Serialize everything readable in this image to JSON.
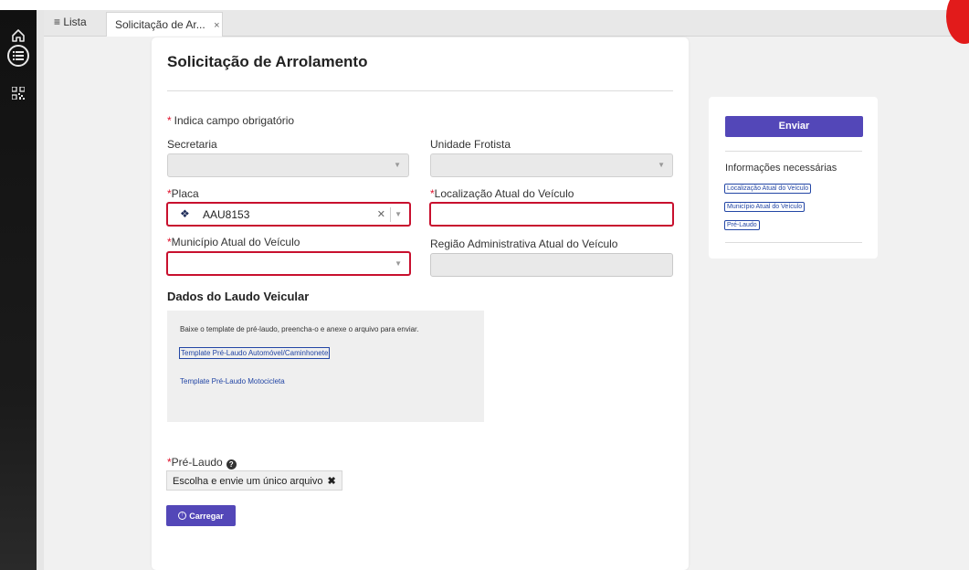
{
  "tabs": {
    "list_label": "≡ Lista",
    "active_label": "Solicitação de Ar...",
    "close_glyph": "×"
  },
  "sidebar_icons": [
    "home-icon",
    "menu-icon",
    "qr-code-icon"
  ],
  "form": {
    "title": "Solicitação de Arrolamento",
    "required_note": "Indica campo obrigatório",
    "secretaria_label": "Secretaria",
    "unidade_label": "Unidade Frotista",
    "placa_label": "Placa",
    "placa_value": "AAU8153",
    "localizacao_label": "Localização Atual do Veículo",
    "localizacao_value": "",
    "municipio_label": "Município Atual do Veículo",
    "municipio_value": "",
    "regiao_label": "Região Administrativa Atual do Veículo",
    "regiao_value": "",
    "section_title": "Dados do Laudo Veicular",
    "laudo_instructions": "Baixe o template de pré-laudo, preencha-o e anexe o arquivo para enviar.",
    "link_automovel": "Template Pré-Laudo Automóvel/Caminhonete",
    "link_motocicleta": "Template Pré-Laudo Motocicleta",
    "prelaudo_label": "Pré-Laudo",
    "file_placeholder": "Escolha e envie um único arquivo",
    "upload_button": "Carregar"
  },
  "side_panel": {
    "submit_button": "Enviar",
    "info_title": "Informações necessárias",
    "missing_fields": [
      "Localização Atual do Veículo",
      "Município Atual do Veículo",
      "Pré-Laudo"
    ]
  },
  "colors": {
    "accent": "#5347b8",
    "error": "#c8102e",
    "link": "#2346a5"
  }
}
